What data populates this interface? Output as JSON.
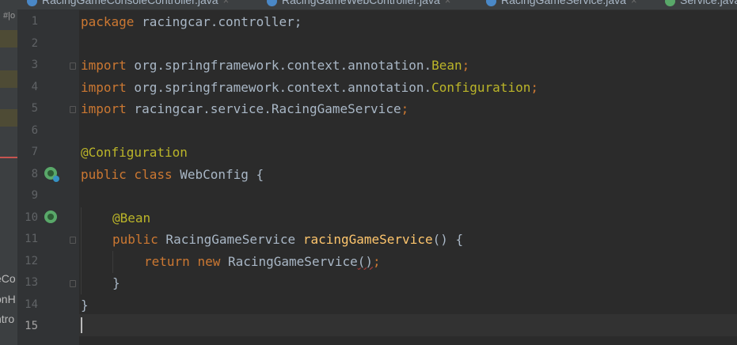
{
  "tabs": [
    {
      "label": "RacingGameConsoleController.java",
      "close": "×",
      "color": "#4a88c7",
      "active": false
    },
    {
      "label": "RacingGameWebController.java",
      "close": "×",
      "color": "#4a88c7",
      "active": false
    },
    {
      "label": "RacingGameService.java",
      "close": "×",
      "color": "#4a88c7",
      "active": true
    },
    {
      "label": "Service.java",
      "close": "×",
      "color": "#59a869",
      "active": false
    }
  ],
  "side_panel": {
    "vertical_label": "#|o",
    "fragments": [
      "eCo",
      "onH",
      "ntro"
    ]
  },
  "gutter": {
    "line_numbers": [
      "1",
      "2",
      "3",
      "4",
      "5",
      "6",
      "7",
      "8",
      "9",
      "10",
      "11",
      "12",
      "13",
      "14",
      "15"
    ],
    "current_line": "15",
    "markers": [
      "spring-bean-icon",
      "spring-bean-icon"
    ]
  },
  "code": {
    "line1": {
      "kw": "package",
      "rest": " racingcar.controller;"
    },
    "line3": {
      "kw": "import",
      "pkg": " org.springframework.context.annotation.",
      "cls": "Bean",
      "semi": ";"
    },
    "line4": {
      "kw": "import",
      "pkg": " org.springframework.context.annotation.",
      "cls": "Configuration",
      "semi": ";"
    },
    "line5": {
      "kw": "import",
      "pkg": " racingcar.service.RacingGameService",
      "semi": ";"
    },
    "line7": {
      "ann": "@Configuration"
    },
    "line8": {
      "kw": "public class",
      "rest": " WebConfig {"
    },
    "line10": {
      "ann": "@Bean"
    },
    "line11": {
      "kw": "public",
      "type": " RacingGameService ",
      "fn": "racingGameService",
      "rest": "() {"
    },
    "line12": {
      "kw1": "return",
      "kw2": "new",
      "type": " RacingGameService",
      "paren": "()",
      "semi": ";"
    },
    "line13": {
      "text": "}"
    },
    "line14": {
      "text": "}"
    }
  },
  "colors": {
    "background": "#2b2b2b",
    "keyword": "#cc7832",
    "annotation": "#bbb529",
    "method": "#ffc66d",
    "text": "#a9b7c6"
  }
}
